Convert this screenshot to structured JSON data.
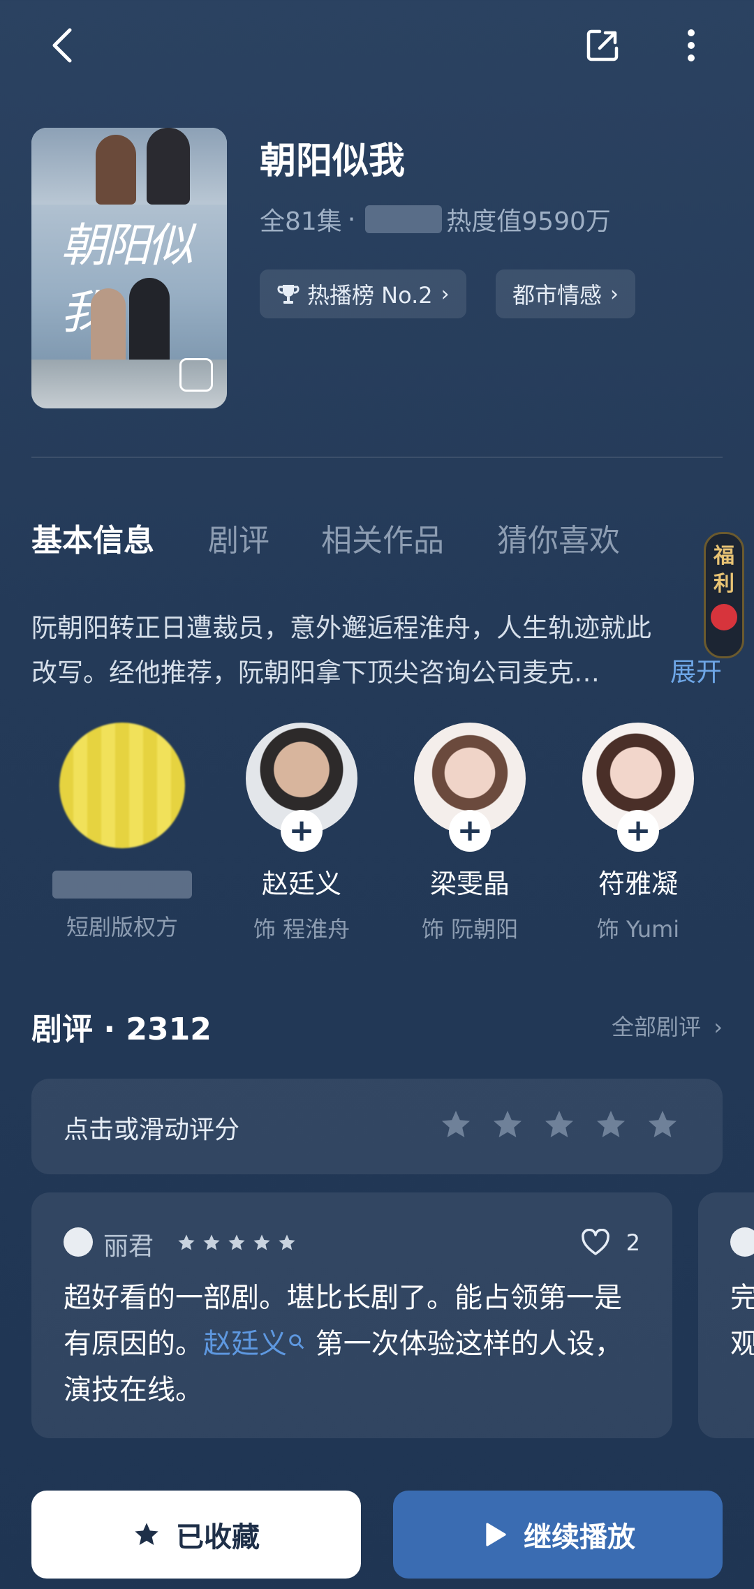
{
  "header": {
    "back_icon": "back-icon",
    "share_icon": "share-icon",
    "more_icon": "more-vertical-icon"
  },
  "show": {
    "title": "朝阳似我",
    "poster_calligraphy": "朝阳似我",
    "episodes": "全81集",
    "meta_separator": "·",
    "heat": "热度值9590万",
    "chips": [
      {
        "label": "热播榜 No.2",
        "icon": "trophy-icon"
      },
      {
        "label": "都市情感",
        "icon": ""
      }
    ]
  },
  "tabs": [
    "基本信息",
    "剧评",
    "相关作品",
    "猜你喜欢"
  ],
  "description": {
    "text": "阮朝阳转正日遭裁员，意外邂逅程淮舟，人生轨迹就此改写。经他推荐，阮朝阳拿下顶尖咨询公司麦克…",
    "expand": "展开"
  },
  "badge": {
    "line1": "福",
    "line2": "利"
  },
  "cast": [
    {
      "name": "",
      "role": "短剧版权方"
    },
    {
      "name": "赵廷义",
      "role": "饰 程淮舟"
    },
    {
      "name": "梁雯晶",
      "role": "饰 阮朝阳"
    },
    {
      "name": "符雅凝",
      "role": "饰 Yumi"
    }
  ],
  "reviews_section": {
    "title": "剧评 · 2312",
    "all_link": "全部剧评",
    "rate_prompt": "点击或滑动评分",
    "rating_stars": 5
  },
  "review": {
    "user": "丽君",
    "stars": 5,
    "likes": "2",
    "text_before": "超好看的一部剧。堪比长剧了。能占领第一是有原因的。",
    "mention": "赵廷义",
    "text_after": " 第一次体验这样的人设，演技在线。",
    "peek_text": "完\n观"
  },
  "actions": {
    "favorite": "已收藏",
    "play": "继续播放"
  },
  "colors": {
    "accent": "#3a6cb2",
    "link": "#6ea6e6",
    "badge_gold": "#e8c374"
  }
}
